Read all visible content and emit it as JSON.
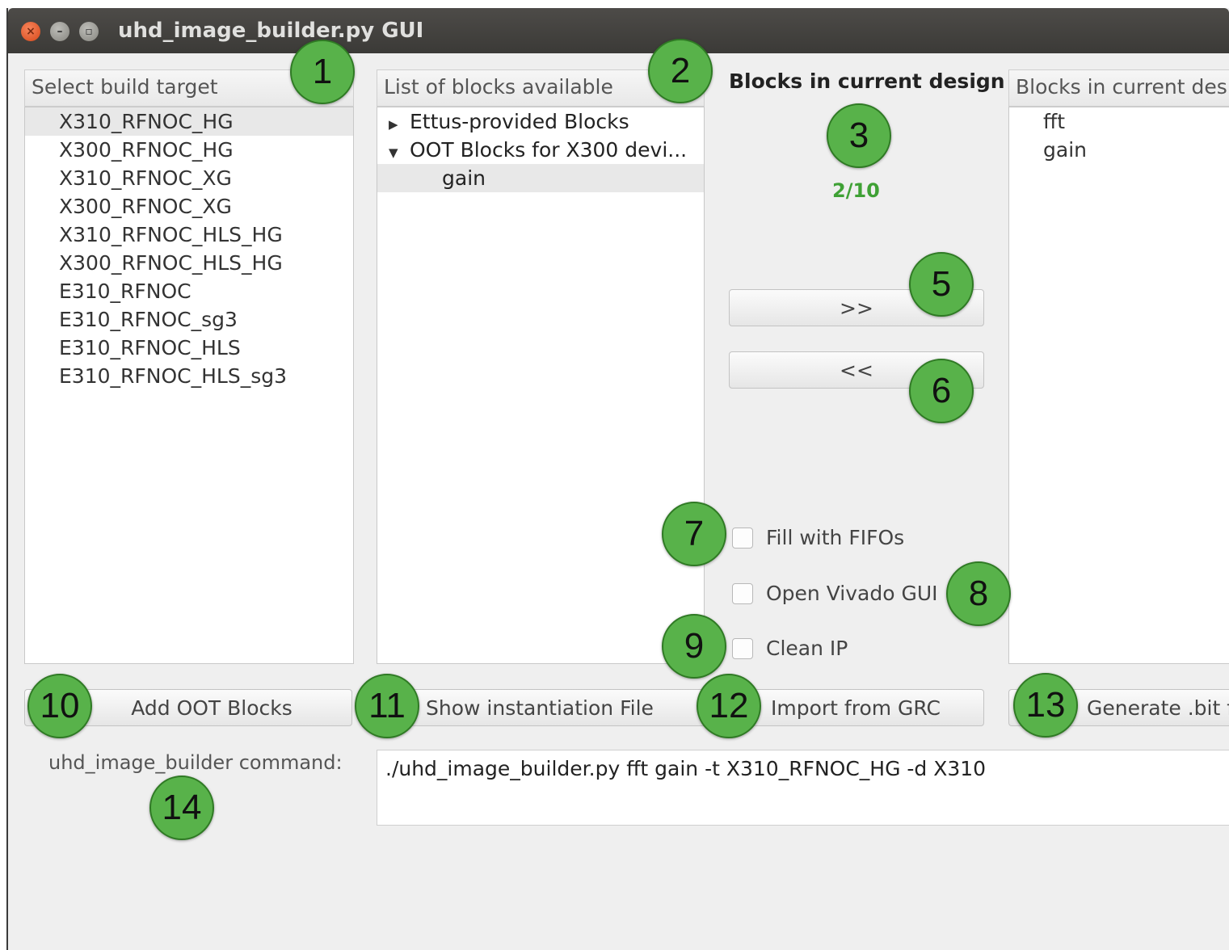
{
  "window": {
    "title": "uhd_image_builder.py GUI",
    "close_glyph": "×",
    "min_glyph": "–",
    "max_glyph": "▫"
  },
  "targets": {
    "header": "Select build target",
    "items": [
      "X310_RFNOC_HG",
      "X300_RFNOC_HG",
      "X310_RFNOC_XG",
      "X300_RFNOC_XG",
      "X310_RFNOC_HLS_HG",
      "X300_RFNOC_HLS_HG",
      "E310_RFNOC",
      "E310_RFNOC_sg3",
      "E310_RFNOC_HLS",
      "E310_RFNOC_HLS_sg3"
    ],
    "selected": "X310_RFNOC_HG"
  },
  "available": {
    "header": "List of blocks available",
    "groups": [
      {
        "label": "Ettus-provided Blocks",
        "arrow": "▶"
      },
      {
        "label": "OOT Blocks for X300 devi...",
        "arrow": "▼"
      }
    ],
    "child": "gain"
  },
  "design": {
    "title": "Blocks in current design",
    "count": "2/10",
    "add_label": ">>",
    "remove_label": "<<",
    "list_header": "Blocks in current desi",
    "blocks": [
      "fft",
      "gain"
    ]
  },
  "options": {
    "fill_fifos": "Fill with FIFOs",
    "open_vivado": "Open Vivado GUI",
    "clean_ip": "Clean IP"
  },
  "buttons": {
    "add_oot": "Add OOT Blocks",
    "show_inst": "Show instantiation File",
    "import_grc": "Import from GRC",
    "generate_bit": "Generate .bit f"
  },
  "command": {
    "label": "uhd_image_builder command:",
    "value": "./uhd_image_builder.py fft gain -t X310_RFNOC_HG -d X310"
  },
  "badges": [
    "1",
    "2",
    "3",
    "5",
    "6",
    "7",
    "8",
    "9",
    "10",
    "11",
    "12",
    "13",
    "14"
  ]
}
